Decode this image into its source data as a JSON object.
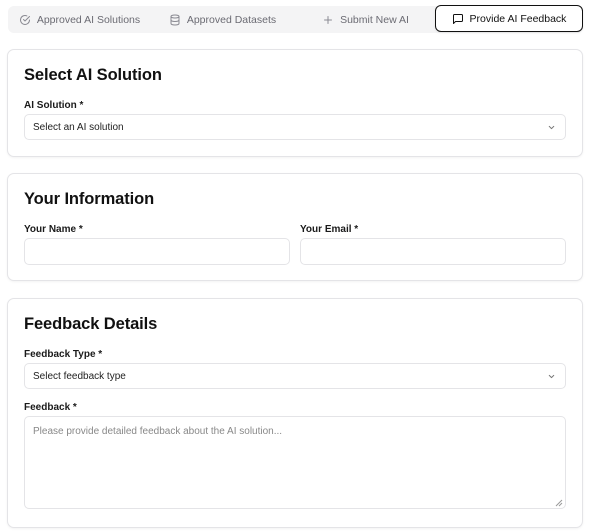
{
  "tabs": [
    {
      "label": "Approved AI Solutions",
      "icon": "check-circle-icon"
    },
    {
      "label": "Approved Datasets",
      "icon": "database-icon"
    },
    {
      "label": "Submit New AI",
      "icon": "plus-icon"
    },
    {
      "label": "Provide AI Feedback",
      "icon": "message-square-icon",
      "active": true
    }
  ],
  "select_solution": {
    "title": "Select AI Solution",
    "label": "AI Solution *",
    "value": "Select an AI solution"
  },
  "your_info": {
    "title": "Your Information",
    "name_label": "Your Name *",
    "name_value": "",
    "email_label": "Your Email *",
    "email_value": ""
  },
  "feedback": {
    "title": "Feedback Details",
    "type_label": "Feedback Type *",
    "type_value": "Select feedback type",
    "text_label": "Feedback *",
    "text_placeholder": "Please provide detailed feedback about the AI solution..."
  }
}
